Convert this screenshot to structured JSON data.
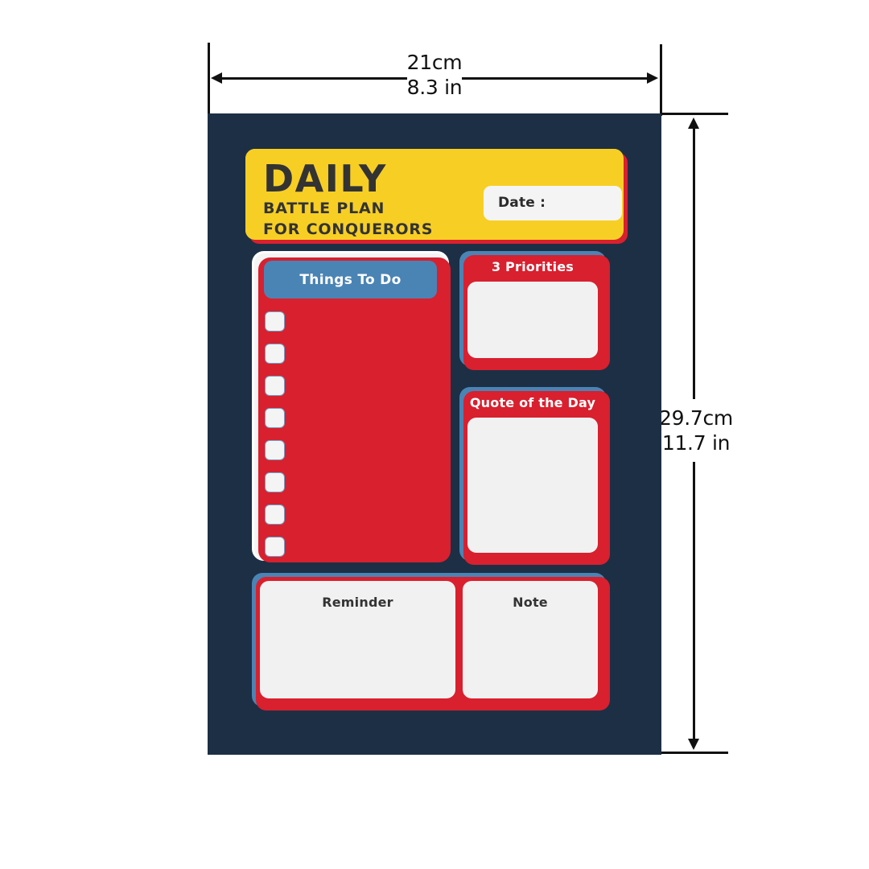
{
  "dimensions": {
    "width_cm": "21cm",
    "width_in": "8.3 in",
    "height_cm": "29.7cm",
    "height_in": "11.7 in"
  },
  "colors": {
    "page_background": "#1d2f45",
    "header_yellow": "#f7cf24",
    "accent_red": "#d8202f",
    "accent_blue": "#4a84b4",
    "panel_light": "#f1f1f1",
    "text_dark": "#333333"
  },
  "header": {
    "title_main": "DAILY",
    "title_sub1": "BATTLE PLAN",
    "title_sub2": "FOR CONQUERORS",
    "date_label": "Date :",
    "date_value": ""
  },
  "todo": {
    "heading": "Things To Do",
    "items": [
      "",
      "",
      "",
      "",
      "",
      "",
      "",
      ""
    ]
  },
  "priorities": {
    "heading": "3 Priorities",
    "value": ""
  },
  "quote": {
    "heading": "Quote of the Day",
    "value": ""
  },
  "reminder": {
    "heading": "Reminder",
    "value": ""
  },
  "note": {
    "heading": "Note",
    "value": ""
  }
}
